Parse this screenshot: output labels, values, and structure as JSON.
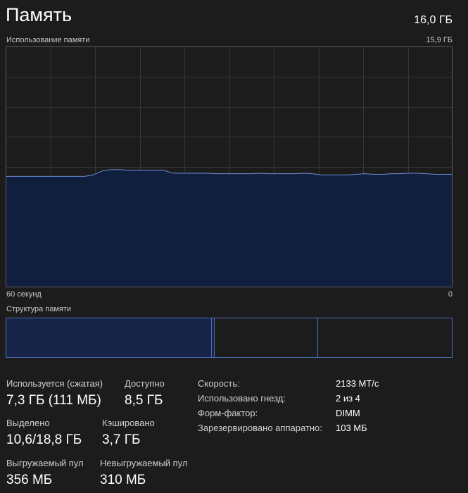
{
  "header": {
    "title": "Память",
    "total": "16,0 ГБ"
  },
  "chart": {
    "label": "Использование памяти",
    "max_label": "15,9 ГБ",
    "axis_left": "60 секунд",
    "axis_right": "0"
  },
  "chart_data": {
    "type": "area",
    "ylim": [
      0,
      15.9
    ],
    "x_range_seconds": [
      60,
      0
    ],
    "grid": true,
    "series": [
      {
        "values": [
          7.33,
          7.33,
          7.33,
          7.33,
          7.33,
          7.33,
          7.33,
          7.33,
          7.33,
          7.33,
          7.42,
          7.68,
          7.77,
          7.77,
          7.73,
          7.73,
          7.73,
          7.73,
          7.73,
          7.55,
          7.53,
          7.53,
          7.53,
          7.53,
          7.5,
          7.5,
          7.5,
          7.5,
          7.5,
          7.53,
          7.5,
          7.5,
          7.5,
          7.5,
          7.53,
          7.5,
          7.42,
          7.42,
          7.42,
          7.42,
          7.46,
          7.5,
          7.46,
          7.46,
          7.5,
          7.5,
          7.53,
          7.53,
          7.5,
          7.46,
          7.46,
          7.46
        ]
      }
    ],
    "colors": {
      "line": "#6f8fd6",
      "fill": "#111f3e",
      "grid": "#363636",
      "border": "#5a5a5a"
    }
  },
  "structure": {
    "label": "Структура памяти",
    "segments": {
      "used_gb": 7.3,
      "modified_gb": 0.1,
      "standby_gb": 3.7,
      "free_gb": 4.8
    }
  },
  "stats": {
    "in_use_label": "Используется (сжатая)",
    "in_use_value": "7,3 ГБ (111 МБ)",
    "available_label": "Доступно",
    "available_value": "8,5 ГБ",
    "committed_label": "Выделено",
    "committed_value": "10,6/18,8 ГБ",
    "cached_label": "Кэшировано",
    "cached_value": "3,7 ГБ",
    "paged_pool_label": "Выгружаемый пул",
    "paged_pool_value": "356 МБ",
    "nonpaged_pool_label": "Невыгружаемый пул",
    "nonpaged_pool_value": "310 МБ"
  },
  "properties": {
    "speed_label": "Скорость:",
    "speed_value": "2133 МТ/с",
    "slots_label": "Использовано гнезд:",
    "slots_value": "2 из 4",
    "form_factor_label": "Форм-фактор:",
    "form_factor_value": "DIMM",
    "reserved_label": "Зарезервировано аппаратно:",
    "reserved_value": "103 МБ"
  }
}
